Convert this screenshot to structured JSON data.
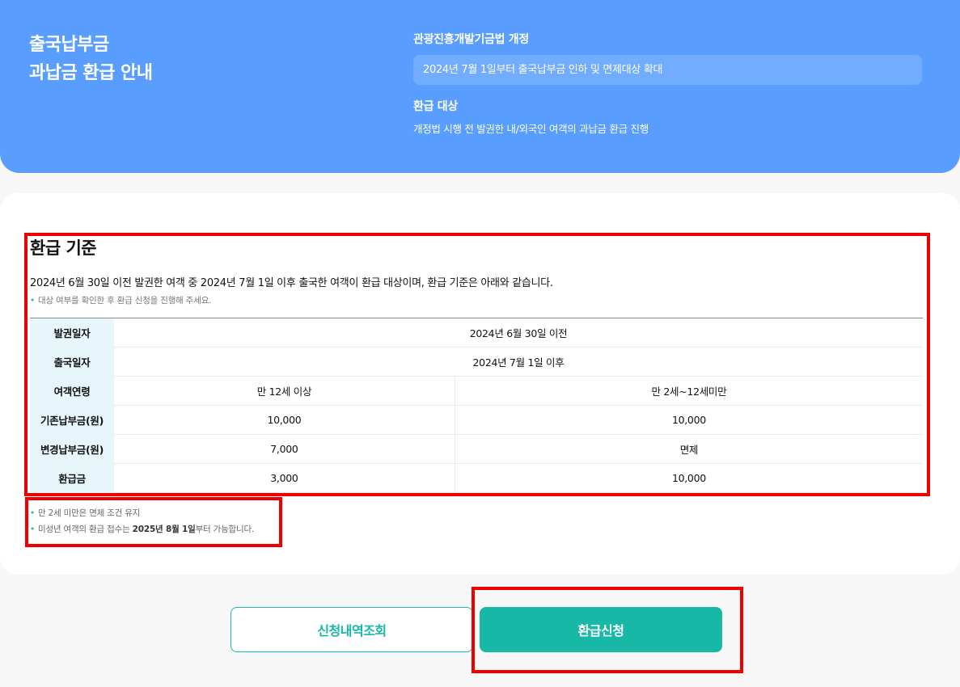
{
  "hero": {
    "title_line1": "출국납부금",
    "title_line2": "과납금 환급 안내",
    "law_title": "관광진흥개발기금법 개정",
    "law_desc": "2024년 7월 1일부터 출국납부금 인하 및 면제대상 확대",
    "target_title": "환급 대상",
    "target_desc": "개정법 시행 전 발권한 내/외국인 여객의 과납금 환급 진행"
  },
  "criteria": {
    "title": "환급 기준",
    "desc": "2024년 6월 30일 이전 발권한 여객 중 2024년 7월 1일 이후 출국한 여객이 환급 대상이며, 환급 기준은 아래와 같습니다.",
    "note": "대상 여부를 확인한 후 환급 신청을 진행해 주세요.",
    "table": {
      "issue_date_label": "발권일자",
      "issue_date_value": "2024년 6월 30일 이전",
      "departure_date_label": "출국일자",
      "departure_date_value": "2024년 7월 1일 이후",
      "age_label": "여객연령",
      "age_adult": "만 12세 이상",
      "age_child": "만 2세~12세미만",
      "old_fee_label": "기존납부금(원)",
      "old_fee_adult": "10,000",
      "old_fee_child": "10,000",
      "new_fee_label": "변경납부금(원)",
      "new_fee_adult": "7,000",
      "new_fee_child": "면제",
      "refund_label": "환급금",
      "refund_adult": "3,000",
      "refund_child": "10,000"
    },
    "footnote1": "만 2세 미만은 면제 조건 유지",
    "footnote2_prefix": "미성년 여객의 환급 접수는 ",
    "footnote2_bold": "2025년 8월 1일",
    "footnote2_suffix": "부터 가능합니다."
  },
  "buttons": {
    "history_label": "신청내역조회",
    "apply_label": "환급신청"
  },
  "colors": {
    "hero_bg": "#599dfe",
    "accent": "#18b8a6",
    "highlight": "#ee0000"
  }
}
